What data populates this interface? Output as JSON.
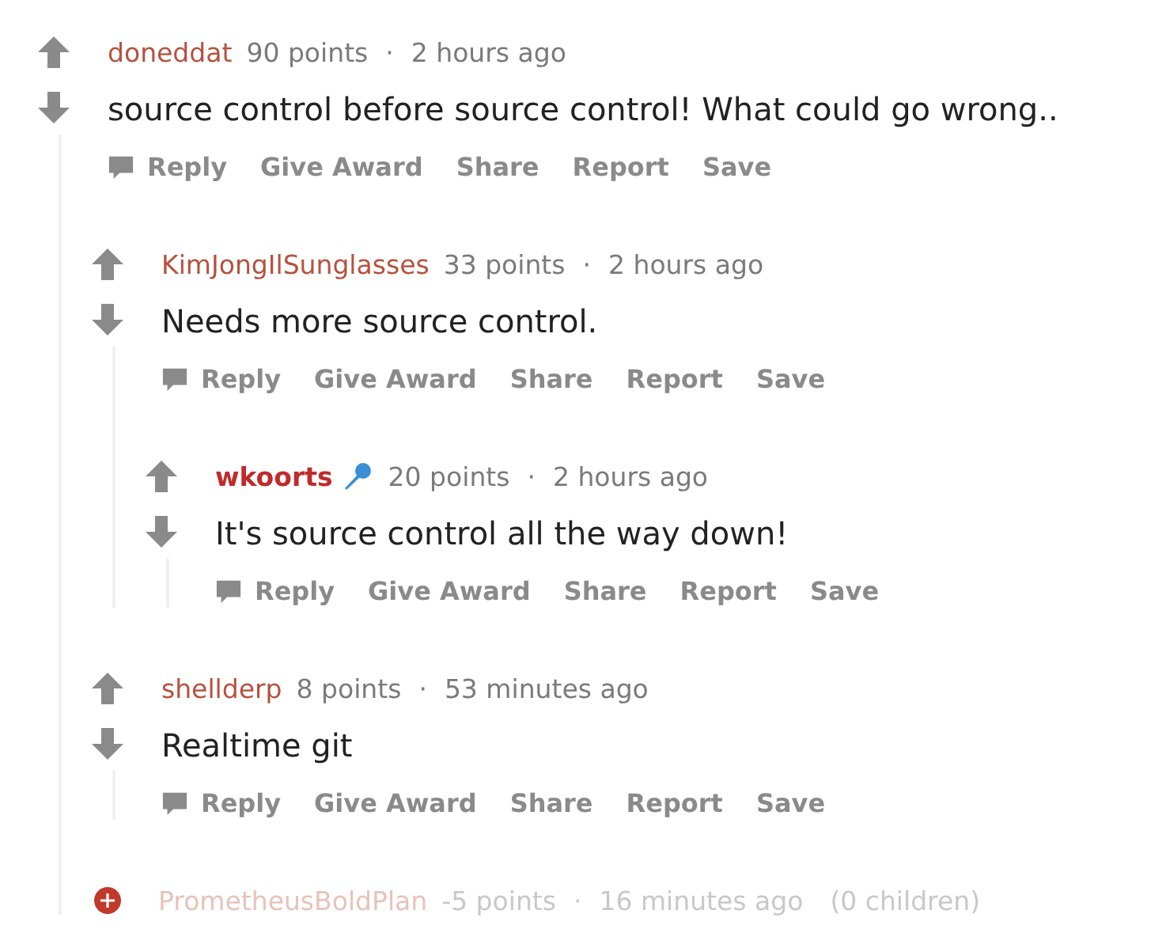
{
  "comments": [
    {
      "kind": "comment",
      "author": "doneddat",
      "submitter": false,
      "points": "90 points",
      "separator": "·",
      "time": "2 hours ago",
      "body": "source control before source control! What could go wrong..",
      "actions": [
        "Reply",
        "Give Award",
        "Share",
        "Report",
        "Save"
      ],
      "children": [
        {
          "kind": "comment",
          "author": "KimJongIlSunglasses",
          "submitter": false,
          "points": "33 points",
          "separator": "·",
          "time": "2 hours ago",
          "body": "Needs more source control.",
          "actions": [
            "Reply",
            "Give Award",
            "Share",
            "Report",
            "Save"
          ],
          "children": [
            {
              "kind": "comment",
              "author": "wkoorts",
              "submitter": true,
              "has_flair": true,
              "points": "20 points",
              "separator": "·",
              "time": "2 hours ago",
              "body": "It's source control all the way down!",
              "actions": [
                "Reply",
                "Give Award",
                "Share",
                "Report",
                "Save"
              ]
            }
          ]
        },
        {
          "kind": "comment",
          "author": "shellderp",
          "submitter": false,
          "points": "8 points",
          "separator": "·",
          "time": "53 minutes ago",
          "body": "Realtime git",
          "actions": [
            "Reply",
            "Give Award",
            "Share",
            "Report",
            "Save"
          ]
        },
        {
          "kind": "collapsed",
          "author": "PrometheusBoldPlan",
          "points": "-5 points",
          "separator": "·",
          "time": "16 minutes ago",
          "note": "(0 children)"
        }
      ]
    }
  ]
}
